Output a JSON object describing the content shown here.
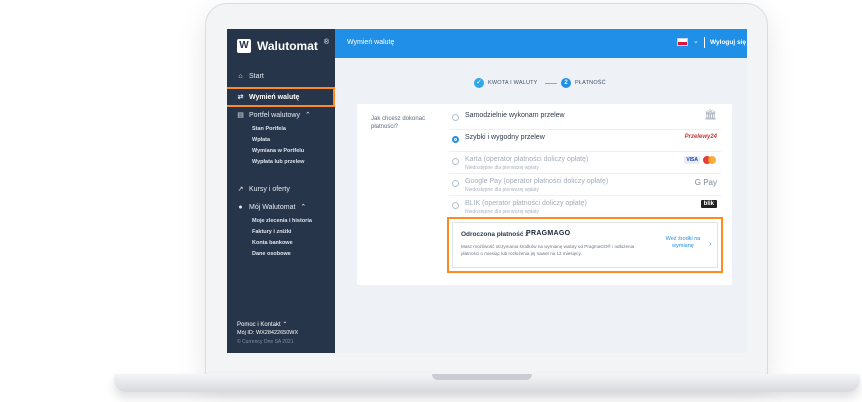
{
  "app": {
    "name": "Walutomat",
    "reg": "®"
  },
  "topbar": {
    "title": "Wymień walutę",
    "logout": "Wyloguj się",
    "language": "PL"
  },
  "sidebar": {
    "items": [
      {
        "label": "Start",
        "icon": "home-icon"
      },
      {
        "label": "Wymień walutę",
        "icon": "exchange-icon",
        "active": true
      },
      {
        "label": "Portfel walutowy",
        "icon": "wallet-icon"
      },
      {
        "label": "Kursy i oferty",
        "icon": "chart-icon"
      },
      {
        "label": "Mój Walutomat",
        "icon": "user-icon"
      }
    ],
    "wallet_sub": [
      "Stan Portfela",
      "Wpłata",
      "Wymiana w Portfelu",
      "Wypłata lub przelew"
    ],
    "account_sub": [
      "Moje zlecenia i historia",
      "Faktury i zniżki",
      "Konta bankowe",
      "Dane osobowe"
    ],
    "footer": {
      "help": "Pomoc i Kontakt",
      "id": "Mój ID: WX28422650WX",
      "copyright": "© Currency One SA 2021"
    }
  },
  "steps": [
    {
      "label": "KWOTA I WALUTY",
      "state": "done",
      "mark": "✓"
    },
    {
      "label": "PŁATNOŚĆ",
      "state": "current",
      "mark": "2"
    }
  ],
  "payment": {
    "question": "Jak chcesz dokonać płatności?",
    "options": [
      {
        "label": "Samodzielnie wykonam przelew",
        "sub": "",
        "selected": false,
        "disabled": false,
        "logo": "bank-icon"
      },
      {
        "label": "Szybki i wygodny przelew",
        "sub": "",
        "selected": true,
        "disabled": false,
        "logo": "Przelewy24"
      },
      {
        "label": "Karta (operator płatności doliczy opłatę)",
        "sub": "Niedostępne dla pierwszej wpłaty",
        "selected": false,
        "disabled": true,
        "logo": "VISA"
      },
      {
        "label": "Google Pay (operator płatności doliczy opłatę)",
        "sub": "Niedostępne dla pierwszej wpłaty",
        "selected": false,
        "disabled": true,
        "logo": "G Pay"
      },
      {
        "label": "BLIK (operator płatności doliczy opłatę)",
        "sub": "Niedostępne dla pierwszej wpłaty",
        "selected": false,
        "disabled": true,
        "logo": "blik"
      }
    ],
    "deferred": {
      "title": "Odroczona płatność z",
      "brand": "PRAGMAGO",
      "desc": "Masz możliwość otrzymania środków na wymianę waluty od PragmaGO® i odłożenia płatności o miesiąc lub rozłożenia jej nawet na 12 miesięcy.",
      "link": "Weź środki na wymianę"
    }
  },
  "colors": {
    "accent": "#1f8fe8",
    "sidebar": "#27354a",
    "highlight": "#ff8a1f"
  }
}
